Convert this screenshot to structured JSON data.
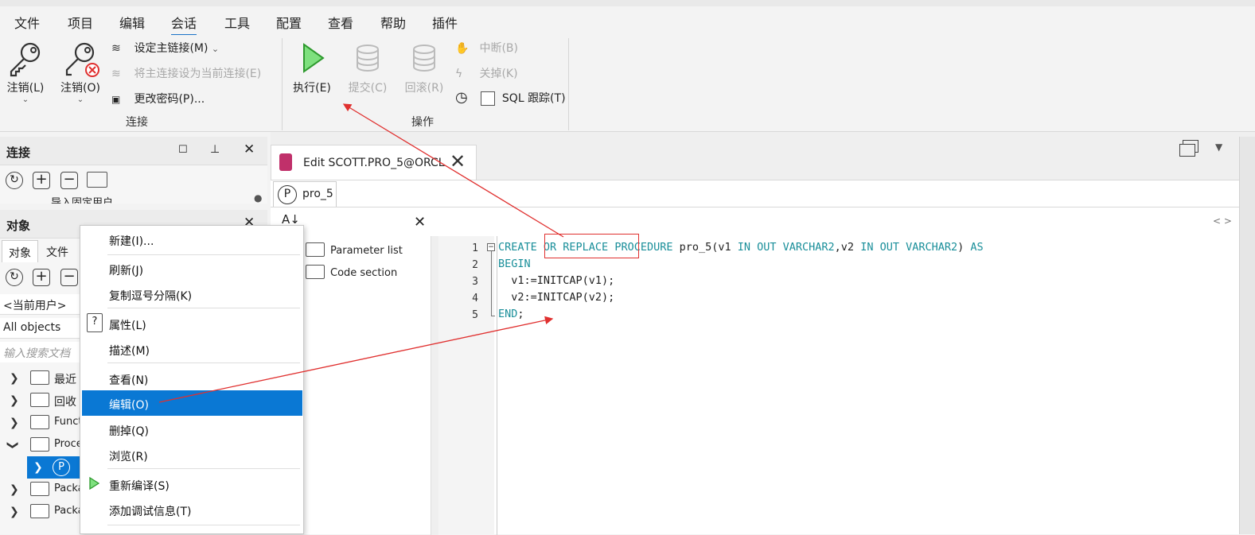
{
  "menu": {
    "items": [
      "文件",
      "项目",
      "编辑",
      "会话",
      "工具",
      "配置",
      "查看",
      "帮助",
      "插件"
    ],
    "active": "会话"
  },
  "ribbon": {
    "logout1": "注销(L)",
    "logout2": "注销(O)",
    "set_main_link": "设定主链接(M)",
    "set_main_as_current": "将主连接设为当前连接(E)",
    "change_password": "更改密码(P)...",
    "group_connect": "连接",
    "execute": "执行(E)",
    "commit": "提交(C)",
    "rollback": "回滚(R)",
    "break": "中断(B)",
    "close": "关掉(K)",
    "sql_trace": "SQL 跟踪(T)",
    "group_operation": "操作"
  },
  "connect_panel": {
    "title": "连接",
    "truncated_item": "导入固定用户"
  },
  "object_panel": {
    "title": "对象",
    "tabs": [
      "对象",
      "文件"
    ],
    "user_select": "<当前用户>",
    "type_select": "All objects",
    "search_placeholder": "输入搜索文档",
    "tree": [
      {
        "label": "最近",
        "expanded": false
      },
      {
        "label": "回收",
        "expanded": false
      },
      {
        "label": "Functi",
        "expanded": false
      },
      {
        "label": "Proce",
        "expanded": true
      },
      {
        "label": "",
        "expanded": false,
        "child": true
      },
      {
        "label": "Packa",
        "expanded": false
      },
      {
        "label": "Packa",
        "expanded": false
      }
    ]
  },
  "context_menu": {
    "items": [
      "新建(I)...",
      "刷新(J)",
      "复制逗号分隔(K)",
      "属性(L)",
      "描述(M)",
      "查看(N)",
      "编辑(O)",
      "删掉(Q)",
      "浏览(R)",
      "重新编译(S)",
      "添加调试信息(T)"
    ],
    "highlighted": "编辑(O)"
  },
  "editor": {
    "tab_title": "Edit SCOTT.PRO_5@ORCL",
    "subtab": "pro_5",
    "nav_items": [
      "Parameter list",
      "Code section"
    ],
    "line_numbers": [
      "1",
      "2",
      "3",
      "4",
      "5"
    ],
    "code": [
      [
        {
          "t": "CREATE ",
          "k": true
        },
        {
          "t": "OR REPLACE",
          "k": true
        },
        {
          "t": " PROCEDURE ",
          "k": true
        },
        {
          "t": "pro_5(v1 ",
          "k": false
        },
        {
          "t": "IN OUT VARCHAR2",
          "k": true
        },
        {
          "t": ",v2 ",
          "k": false
        },
        {
          "t": "IN OUT VARCHAR2",
          "k": true
        },
        {
          "t": ") ",
          "k": false
        },
        {
          "t": "AS",
          "k": true
        }
      ],
      [
        {
          "t": "BEGIN",
          "k": true
        }
      ],
      [
        {
          "t": "  v1:=INITCAP(v1);",
          "k": false
        }
      ],
      [
        {
          "t": "  v2:=INITCAP(v2);",
          "k": false
        }
      ],
      [
        {
          "t": "END",
          "k": true
        },
        {
          "t": ";",
          "k": false
        }
      ]
    ],
    "nav_arrows": "< >"
  },
  "colors": {
    "accent": "#1a73c8",
    "highlight_bg": "#0a78d4",
    "keyword": "#1a8f9a",
    "annotation": "#e0302f"
  }
}
